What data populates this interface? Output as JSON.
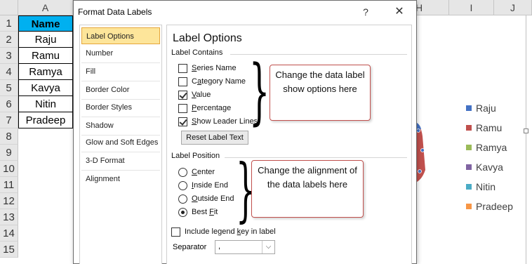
{
  "spreadsheet": {
    "columns": [
      "A",
      "H",
      "I",
      "J"
    ],
    "rows": [
      "1",
      "2",
      "3",
      "4",
      "5",
      "6",
      "7",
      "8",
      "9",
      "10",
      "11",
      "12",
      "13",
      "14",
      "15"
    ],
    "header_cell": "Name",
    "names": [
      "Raju",
      "Ramu",
      "Ramya",
      "Kavya",
      "Nitin",
      "Pradeep"
    ]
  },
  "chart": {
    "legend": [
      {
        "label": "Raju",
        "color": "#4472c4"
      },
      {
        "label": "Ramu",
        "color": "#c0504d"
      },
      {
        "label": "Ramya",
        "color": "#9bbb59"
      },
      {
        "label": "Kavya",
        "color": "#8064a2"
      },
      {
        "label": "Nitin",
        "color": "#4bacc6"
      },
      {
        "label": "Pradeep",
        "color": "#f79646"
      }
    ]
  },
  "dialog": {
    "title": "Format Data Labels",
    "help": "?",
    "close": "✕",
    "nav": [
      "Label Options",
      "Number",
      "Fill",
      "Border Color",
      "Border Styles",
      "Shadow",
      "Glow and Soft Edges",
      "3-D Format",
      "Alignment"
    ],
    "panel_title": "Label Options",
    "label_contains": {
      "heading": "Label Contains",
      "options": [
        {
          "pre": "",
          "ul": "S",
          "post": "eries Name",
          "checked": false
        },
        {
          "pre": "C",
          "ul": "a",
          "post": "tegory Name",
          "checked": false
        },
        {
          "pre": "",
          "ul": "V",
          "post": "alue",
          "checked": true
        },
        {
          "pre": "",
          "ul": "P",
          "post": "ercentage",
          "checked": false
        },
        {
          "pre": "",
          "ul": "S",
          "post": "how Leader Lines",
          "checked": true
        }
      ],
      "reset_button": "Reset Label Text"
    },
    "label_position": {
      "heading": "Label Position",
      "options": [
        {
          "pre": "",
          "ul": "C",
          "post": "enter",
          "checked": false
        },
        {
          "pre": "",
          "ul": "I",
          "post": "nside End",
          "checked": false
        },
        {
          "pre": "",
          "ul": "O",
          "post": "utside End",
          "checked": false
        },
        {
          "pre": "Best ",
          "ul": "F",
          "post": "it",
          "checked": true
        }
      ]
    },
    "legend_key": {
      "pre": "Include legend ",
      "ul": "k",
      "post": "ey in label",
      "checked": false
    },
    "separator": {
      "label": "Separator",
      "value": ","
    }
  },
  "callouts": {
    "options": "Change the data label show options here",
    "alignment": "Change the alignment of the data labels here"
  }
}
